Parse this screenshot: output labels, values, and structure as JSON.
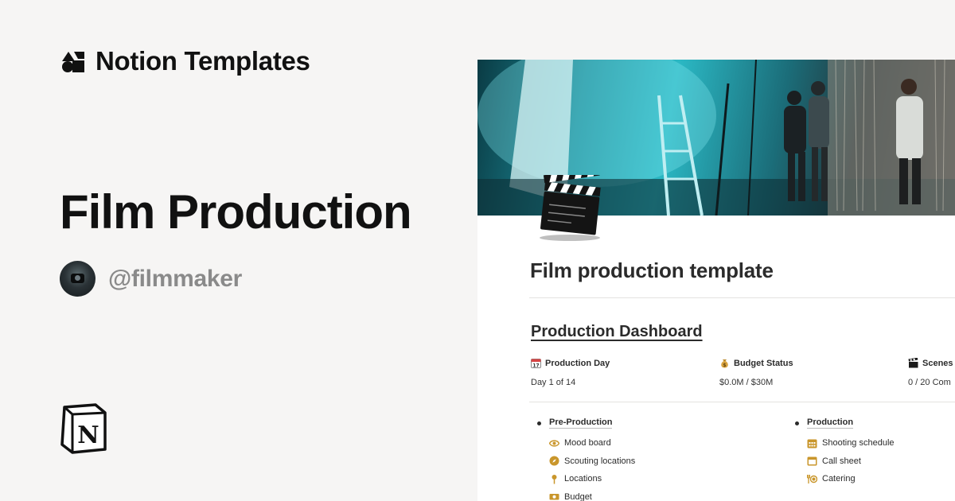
{
  "brand": {
    "name": "Notion Templates",
    "logo_icon": "notion-templates-shapes-icon"
  },
  "hero": {
    "title": "Film Production"
  },
  "author": {
    "handle": "@filmmaker",
    "avatar_icon": "camera-operator-avatar"
  },
  "footer": {
    "logo_icon": "notion-logo-icon"
  },
  "preview": {
    "cover_icon": "film-set-cover-image",
    "page_icon": "clapper-board-icon",
    "page_title": "Film production template",
    "dashboard_heading": "Production Dashboard",
    "stats": [
      {
        "icon": "calendar-icon",
        "label": "Production Day",
        "value": "Day 1 of 14"
      },
      {
        "icon": "money-bag-icon",
        "label": "Budget Status",
        "value": "$0.0M / $30M"
      },
      {
        "icon": "clapper-icon",
        "label": "Scenes",
        "value": "0 / 20 Com"
      }
    ],
    "columns": [
      {
        "title": "Pre-Production",
        "items": [
          {
            "icon": "eye-icon",
            "label": "Mood board"
          },
          {
            "icon": "compass-icon",
            "label": "Scouting locations"
          },
          {
            "icon": "map-pin-icon",
            "label": "Locations"
          },
          {
            "icon": "money-icon",
            "label": "Budget"
          }
        ]
      },
      {
        "title": "Production",
        "items": [
          {
            "icon": "calendar-grid-icon",
            "label": "Shooting schedule"
          },
          {
            "icon": "calendar-sheet-icon",
            "label": "Call sheet"
          },
          {
            "icon": "utensils-icon",
            "label": "Catering"
          }
        ]
      }
    ],
    "accent_color": "#c9962b"
  }
}
